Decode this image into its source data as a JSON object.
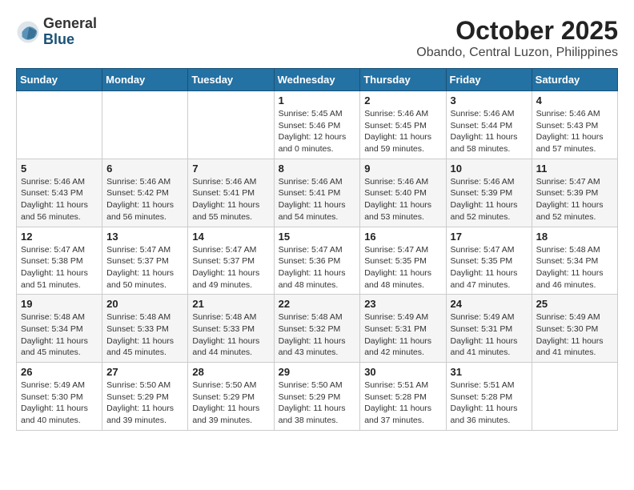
{
  "logo": {
    "general": "General",
    "blue": "Blue"
  },
  "title": "October 2025",
  "location": "Obando, Central Luzon, Philippines",
  "days_of_week": [
    "Sunday",
    "Monday",
    "Tuesday",
    "Wednesday",
    "Thursday",
    "Friday",
    "Saturday"
  ],
  "weeks": [
    [
      {
        "day": "",
        "info": ""
      },
      {
        "day": "",
        "info": ""
      },
      {
        "day": "",
        "info": ""
      },
      {
        "day": "1",
        "info": "Sunrise: 5:45 AM\nSunset: 5:46 PM\nDaylight: 12 hours\nand 0 minutes."
      },
      {
        "day": "2",
        "info": "Sunrise: 5:46 AM\nSunset: 5:45 PM\nDaylight: 11 hours\nand 59 minutes."
      },
      {
        "day": "3",
        "info": "Sunrise: 5:46 AM\nSunset: 5:44 PM\nDaylight: 11 hours\nand 58 minutes."
      },
      {
        "day": "4",
        "info": "Sunrise: 5:46 AM\nSunset: 5:43 PM\nDaylight: 11 hours\nand 57 minutes."
      }
    ],
    [
      {
        "day": "5",
        "info": "Sunrise: 5:46 AM\nSunset: 5:43 PM\nDaylight: 11 hours\nand 56 minutes."
      },
      {
        "day": "6",
        "info": "Sunrise: 5:46 AM\nSunset: 5:42 PM\nDaylight: 11 hours\nand 56 minutes."
      },
      {
        "day": "7",
        "info": "Sunrise: 5:46 AM\nSunset: 5:41 PM\nDaylight: 11 hours\nand 55 minutes."
      },
      {
        "day": "8",
        "info": "Sunrise: 5:46 AM\nSunset: 5:41 PM\nDaylight: 11 hours\nand 54 minutes."
      },
      {
        "day": "9",
        "info": "Sunrise: 5:46 AM\nSunset: 5:40 PM\nDaylight: 11 hours\nand 53 minutes."
      },
      {
        "day": "10",
        "info": "Sunrise: 5:46 AM\nSunset: 5:39 PM\nDaylight: 11 hours\nand 52 minutes."
      },
      {
        "day": "11",
        "info": "Sunrise: 5:47 AM\nSunset: 5:39 PM\nDaylight: 11 hours\nand 52 minutes."
      }
    ],
    [
      {
        "day": "12",
        "info": "Sunrise: 5:47 AM\nSunset: 5:38 PM\nDaylight: 11 hours\nand 51 minutes."
      },
      {
        "day": "13",
        "info": "Sunrise: 5:47 AM\nSunset: 5:37 PM\nDaylight: 11 hours\nand 50 minutes."
      },
      {
        "day": "14",
        "info": "Sunrise: 5:47 AM\nSunset: 5:37 PM\nDaylight: 11 hours\nand 49 minutes."
      },
      {
        "day": "15",
        "info": "Sunrise: 5:47 AM\nSunset: 5:36 PM\nDaylight: 11 hours\nand 48 minutes."
      },
      {
        "day": "16",
        "info": "Sunrise: 5:47 AM\nSunset: 5:35 PM\nDaylight: 11 hours\nand 48 minutes."
      },
      {
        "day": "17",
        "info": "Sunrise: 5:47 AM\nSunset: 5:35 PM\nDaylight: 11 hours\nand 47 minutes."
      },
      {
        "day": "18",
        "info": "Sunrise: 5:48 AM\nSunset: 5:34 PM\nDaylight: 11 hours\nand 46 minutes."
      }
    ],
    [
      {
        "day": "19",
        "info": "Sunrise: 5:48 AM\nSunset: 5:34 PM\nDaylight: 11 hours\nand 45 minutes."
      },
      {
        "day": "20",
        "info": "Sunrise: 5:48 AM\nSunset: 5:33 PM\nDaylight: 11 hours\nand 45 minutes."
      },
      {
        "day": "21",
        "info": "Sunrise: 5:48 AM\nSunset: 5:33 PM\nDaylight: 11 hours\nand 44 minutes."
      },
      {
        "day": "22",
        "info": "Sunrise: 5:48 AM\nSunset: 5:32 PM\nDaylight: 11 hours\nand 43 minutes."
      },
      {
        "day": "23",
        "info": "Sunrise: 5:49 AM\nSunset: 5:31 PM\nDaylight: 11 hours\nand 42 minutes."
      },
      {
        "day": "24",
        "info": "Sunrise: 5:49 AM\nSunset: 5:31 PM\nDaylight: 11 hours\nand 41 minutes."
      },
      {
        "day": "25",
        "info": "Sunrise: 5:49 AM\nSunset: 5:30 PM\nDaylight: 11 hours\nand 41 minutes."
      }
    ],
    [
      {
        "day": "26",
        "info": "Sunrise: 5:49 AM\nSunset: 5:30 PM\nDaylight: 11 hours\nand 40 minutes."
      },
      {
        "day": "27",
        "info": "Sunrise: 5:50 AM\nSunset: 5:29 PM\nDaylight: 11 hours\nand 39 minutes."
      },
      {
        "day": "28",
        "info": "Sunrise: 5:50 AM\nSunset: 5:29 PM\nDaylight: 11 hours\nand 39 minutes."
      },
      {
        "day": "29",
        "info": "Sunrise: 5:50 AM\nSunset: 5:29 PM\nDaylight: 11 hours\nand 38 minutes."
      },
      {
        "day": "30",
        "info": "Sunrise: 5:51 AM\nSunset: 5:28 PM\nDaylight: 11 hours\nand 37 minutes."
      },
      {
        "day": "31",
        "info": "Sunrise: 5:51 AM\nSunset: 5:28 PM\nDaylight: 11 hours\nand 36 minutes."
      },
      {
        "day": "",
        "info": ""
      }
    ]
  ]
}
